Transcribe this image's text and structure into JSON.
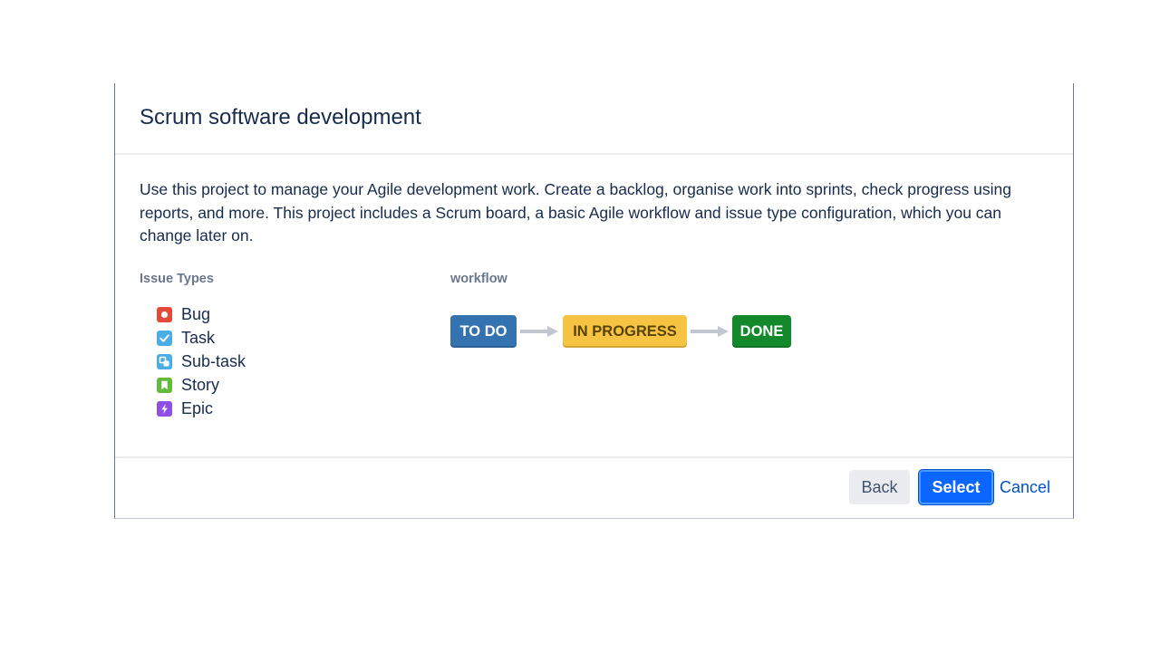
{
  "dialog": {
    "title": "Scrum software development",
    "description": "Use this project to manage your Agile development work. Create a backlog, organise work into sprints, check progress using reports, and more. This project includes a Scrum board, a basic Agile workflow and issue type configuration, which you can change later on."
  },
  "issue_types": {
    "label": "Issue Types",
    "items": [
      {
        "label": "Bug",
        "icon": "bug-icon",
        "color": "#e5493a"
      },
      {
        "label": "Task",
        "icon": "task-icon",
        "color": "#4bade8"
      },
      {
        "label": "Sub-task",
        "icon": "subtask-icon",
        "color": "#4bade8"
      },
      {
        "label": "Story",
        "icon": "story-icon",
        "color": "#63ba3c"
      },
      {
        "label": "Epic",
        "icon": "epic-icon",
        "color": "#904ee2"
      }
    ]
  },
  "workflow": {
    "label": "workflow",
    "steps": [
      {
        "label": "TO DO",
        "color": "#3572b0"
      },
      {
        "label": "IN PROGRESS",
        "color": "#f6c342",
        "text_color": "#594300"
      },
      {
        "label": "DONE",
        "color": "#14892c"
      }
    ]
  },
  "footer": {
    "back_label": "Back",
    "select_label": "Select",
    "cancel_label": "Cancel"
  }
}
